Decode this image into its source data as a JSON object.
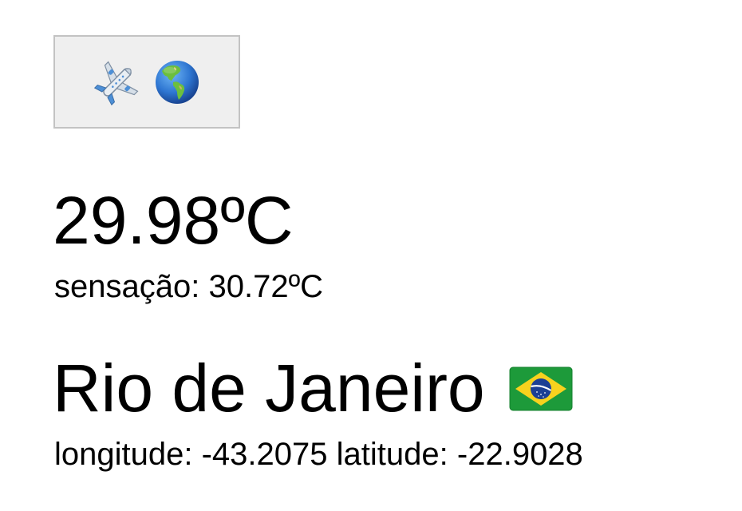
{
  "toolbar": {
    "travel_button": {
      "icons": [
        "airplane-icon",
        "globe-americas-icon"
      ]
    }
  },
  "weather": {
    "temperature": "29.98ºC",
    "feels_like_label": "sensação:",
    "feels_like_value": "30.72ºC"
  },
  "location": {
    "city": "Rio de Janeiro",
    "flag_icon": "brazil-flag-icon",
    "longitude_label": "longitude:",
    "longitude_value": "-43.2075",
    "latitude_label": "latitude:",
    "latitude_value": "-22.9028"
  },
  "colors": {
    "button_bg": "#efefef",
    "button_border": "#c3c3c3",
    "text": "#000000",
    "flag_green": "#1d9a3a",
    "flag_yellow": "#f7d21e",
    "flag_blue": "#1c3f94"
  }
}
